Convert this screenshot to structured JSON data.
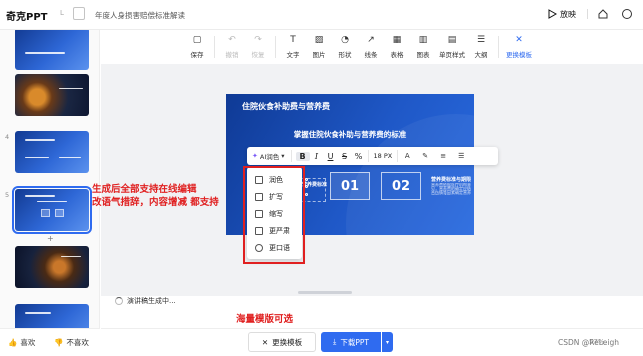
{
  "header": {
    "logo": "奇克PPT",
    "logo_sep": "L",
    "doc_title": "年度人身损害赔偿标准解读",
    "play_label": "放映"
  },
  "slides_panel": {
    "slides": [
      {
        "num": "",
        "style": "blue"
      },
      {
        "num": "",
        "style": "photo"
      },
      {
        "num": "4",
        "style": "blue"
      },
      {
        "num": "5",
        "style": "blue",
        "active": true
      },
      {
        "num": "",
        "style": "photo2"
      },
      {
        "num": "",
        "style": "blue"
      }
    ],
    "add_symbol": "+"
  },
  "toolbar": {
    "tools": [
      {
        "label": "保存",
        "icon": "save-icon",
        "glyph": "▢"
      },
      {
        "label": "撤销",
        "icon": "undo-icon",
        "glyph": "↶",
        "disabled": true
      },
      {
        "label": "恢复",
        "icon": "redo-icon",
        "glyph": "↷",
        "disabled": true
      },
      {
        "label": "文字",
        "icon": "text-icon",
        "glyph": "T"
      },
      {
        "label": "图片",
        "icon": "image-icon",
        "glyph": "▨"
      },
      {
        "label": "形状",
        "icon": "shape-icon",
        "glyph": "◔"
      },
      {
        "label": "线条",
        "icon": "line-icon",
        "glyph": "↗"
      },
      {
        "label": "表格",
        "icon": "table-icon",
        "glyph": "▦"
      },
      {
        "label": "图表",
        "icon": "chart-icon",
        "glyph": "▥"
      },
      {
        "label": "单页样式",
        "icon": "page-style-icon",
        "glyph": "▤"
      },
      {
        "label": "大纲",
        "icon": "outline-icon",
        "glyph": "☰"
      },
      {
        "label": "更换模板",
        "icon": "magic-wand-icon",
        "glyph": "✕",
        "active": true
      }
    ]
  },
  "slide": {
    "title": "住院伙食补助费与营养费",
    "subtitle": "掌握住院伙食补助与营养费的标准",
    "box1": "01",
    "box2": "02",
    "item_title": "营养费标准与期限",
    "item_desc": "营养费依据医疗机构意见，营养费的确定应结合伤情等因素确定营养期限与标准。",
    "selected_text": "营养费标准"
  },
  "format_bar": {
    "ai_label": "AI润色",
    "bold": "B",
    "italic": "I",
    "underline": "U",
    "strike": "S",
    "script": "%",
    "font_size": "18 PX",
    "font_color": "A",
    "highlight": "✎",
    "align": "≡",
    "list": "☰"
  },
  "ai_menu": [
    {
      "label": "润色",
      "icon": "polish-icon"
    },
    {
      "label": "扩写",
      "icon": "expand-icon"
    },
    {
      "label": "缩写",
      "icon": "shorten-icon"
    },
    {
      "label": "更严肃",
      "icon": "serious-icon"
    },
    {
      "label": "更口语",
      "icon": "casual-icon"
    }
  ],
  "annotations": {
    "line1": "生成后全部支持在线编辑",
    "line2": "改语气措辞，内容增减 都支持",
    "template_note": "海量模版可选"
  },
  "status": {
    "text": "演讲稿生成中..."
  },
  "footer": {
    "like": "喜欢",
    "dislike": "不喜欢",
    "change_template": "更换模板",
    "download": "下载PPT",
    "zoom": "57%",
    "watermark": "CSDN @ReLeigh"
  },
  "colors": {
    "accent": "#2f6bf0",
    "annotation_red": "#e02020",
    "slide_blue": "#1f58c7"
  }
}
